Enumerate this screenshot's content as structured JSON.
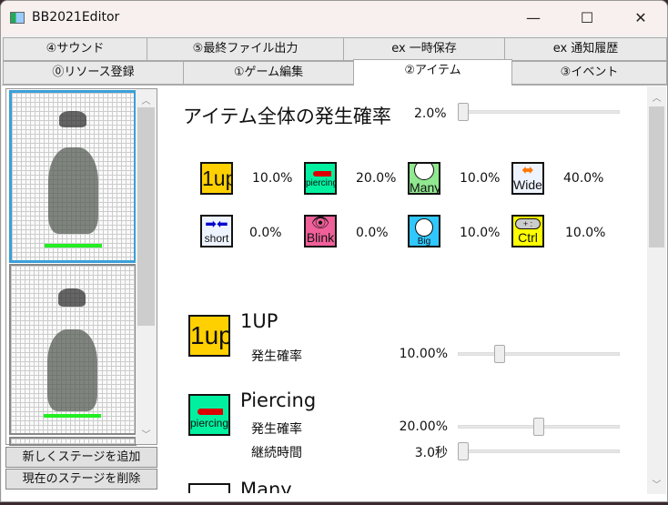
{
  "window": {
    "title": "BB2021Editor",
    "minimize": "—",
    "maximize": "☐",
    "close": "✕"
  },
  "tabs_row1": [
    {
      "label": "④サウンド"
    },
    {
      "label": "⑤最終ファイル出力"
    },
    {
      "label": "ex 一時保存"
    },
    {
      "label": "ex 通知履歴"
    }
  ],
  "tabs_row2": [
    {
      "label": "⓪リソース登録"
    },
    {
      "label": "①ゲーム編集"
    },
    {
      "label": "②アイテム",
      "selected": true
    },
    {
      "label": "③イベント"
    }
  ],
  "left": {
    "add_stage": "新しくステージを追加",
    "delete_stage": "現在のステージを削除"
  },
  "overall": {
    "label": "アイテム全体の発生確率",
    "value": "2.0%",
    "slider_fraction": 0.02
  },
  "items_grid": [
    {
      "icon": "1up-icon",
      "text": "1up",
      "value": "10.0%",
      "bg": "#ffd000"
    },
    {
      "icon": "piercing-icon",
      "text": "piercing",
      "value": "20.0%",
      "bg": "#00f0a0"
    },
    {
      "icon": "many-icon",
      "text": "Many",
      "value": "10.0%",
      "bg": "#90e890"
    },
    {
      "icon": "wide-icon",
      "text": "Wide",
      "value": "40.0%",
      "bg": "#eef4ff"
    },
    {
      "icon": "short-icon",
      "text": "short",
      "value": "0.0%",
      "bg": "#eef4ff"
    },
    {
      "icon": "blink-icon",
      "text": "Blink",
      "value": "0.0%",
      "bg": "#f0609a"
    },
    {
      "icon": "big-ball-icon",
      "text": "Big ball",
      "value": "10.0%",
      "bg": "#30c8ff"
    },
    {
      "icon": "ctrl-icon",
      "text": "Ctrl",
      "value": "10.0%",
      "bg": "#ffff00"
    }
  ],
  "sections": [
    {
      "title": "1UP",
      "icon_text": "1up",
      "rows": [
        {
          "label": "発生確率",
          "value": "10.00%",
          "fraction": 0.2
        }
      ]
    },
    {
      "title": "Piercing",
      "icon_text": "piercing",
      "rows": [
        {
          "label": "発生確率",
          "value": "20.00%",
          "fraction": 0.5
        },
        {
          "label": "継続時間",
          "value": "3.0秒",
          "fraction": 0.0
        }
      ]
    },
    {
      "title": "Many"
    }
  ]
}
